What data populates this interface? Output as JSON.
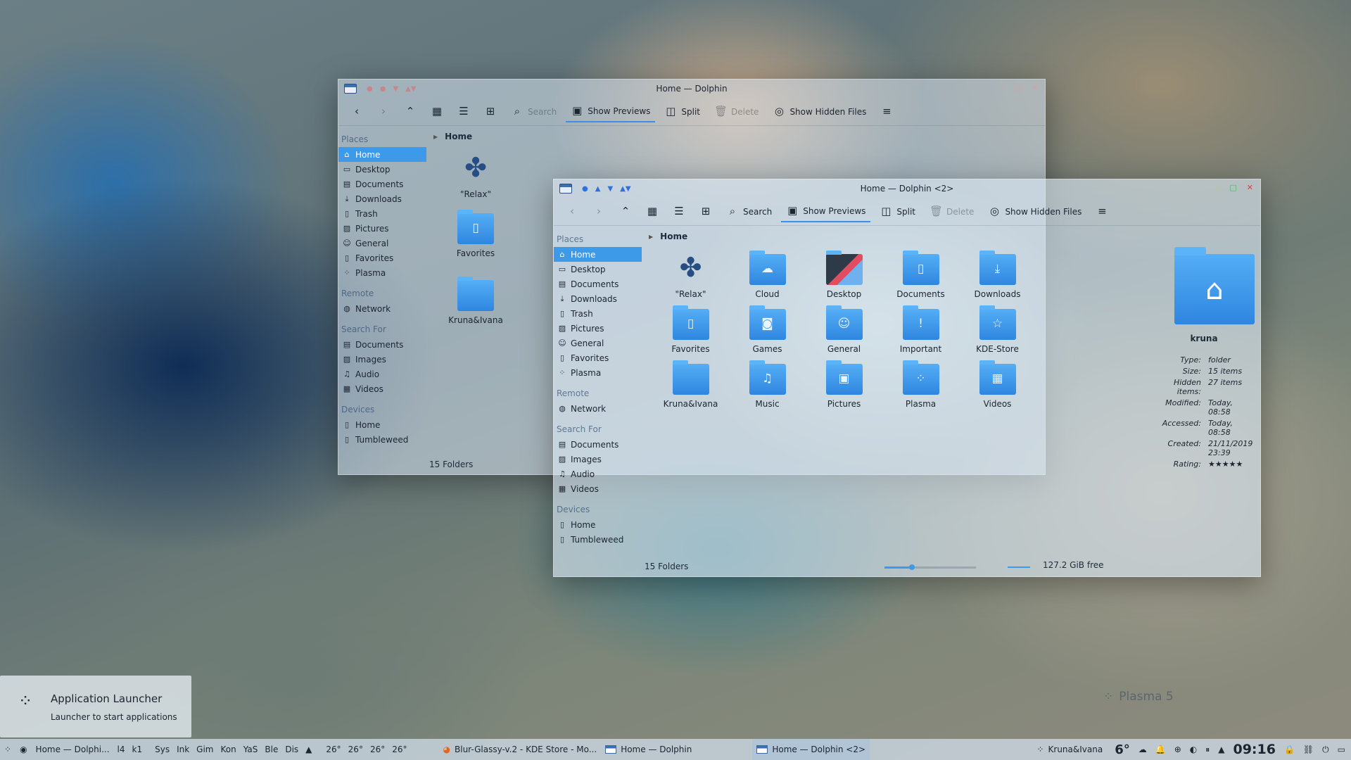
{
  "back_window": {
    "title": "Home — Dolphin",
    "toolbar": {
      "search": "Search",
      "show_previews": "Show Previews",
      "split": "Split",
      "delete": "Delete",
      "show_hidden": "Show Hidden Files"
    },
    "places_head": "Places",
    "places": [
      "Home",
      "Desktop",
      "Documents",
      "Downloads",
      "Trash",
      "Pictures",
      "General",
      "Favorites",
      "Plasma"
    ],
    "remote_head": "Remote",
    "remote": [
      "Network"
    ],
    "search_head": "Search For",
    "search_for": [
      "Documents",
      "Images",
      "Audio",
      "Videos"
    ],
    "devices_head": "Devices",
    "devices": [
      "Home",
      "Tumbleweed"
    ],
    "breadcrumb": "Home",
    "files": [
      "\"Relax\"",
      "Favorites",
      "Kruna&Ivana"
    ],
    "status": "15 Folders"
  },
  "front_window": {
    "title": "Home — Dolphin <2>",
    "toolbar": {
      "search": "Search",
      "show_previews": "Show Previews",
      "split": "Split",
      "delete": "Delete",
      "show_hidden": "Show Hidden Files"
    },
    "places_head": "Places",
    "places": [
      "Home",
      "Desktop",
      "Documents",
      "Downloads",
      "Trash",
      "Pictures",
      "General",
      "Favorites",
      "Plasma"
    ],
    "remote_head": "Remote",
    "remote": [
      "Network"
    ],
    "search_head": "Search For",
    "search_for": [
      "Documents",
      "Images",
      "Audio",
      "Videos"
    ],
    "devices_head": "Devices",
    "devices": [
      "Home",
      "Tumbleweed"
    ],
    "breadcrumb": "Home",
    "files": [
      {
        "name": "\"Relax\"",
        "icon": "relax-icon"
      },
      {
        "name": "Cloud",
        "icon": "cloud-icon"
      },
      {
        "name": "Desktop",
        "icon": "desktop-icon"
      },
      {
        "name": "Documents",
        "icon": "document-icon"
      },
      {
        "name": "Downloads",
        "icon": "download-icon"
      },
      {
        "name": "Favorites",
        "icon": "bookmark-icon"
      },
      {
        "name": "Games",
        "icon": "gamepad-icon"
      },
      {
        "name": "General",
        "icon": "people-icon"
      },
      {
        "name": "Important",
        "icon": "exclamation-icon"
      },
      {
        "name": "KDE-Store",
        "icon": "star-icon"
      },
      {
        "name": "Kruna&Ivana",
        "icon": "folder-icon"
      },
      {
        "name": "Music",
        "icon": "music-icon"
      },
      {
        "name": "Pictures",
        "icon": "picture-icon"
      },
      {
        "name": "Plasma",
        "icon": "plasma-icon"
      },
      {
        "name": "Videos",
        "icon": "film-icon"
      }
    ],
    "info": {
      "name": "kruna",
      "type_k": "Type:",
      "type_v": "folder",
      "size_k": "Size:",
      "size_v": "15 items",
      "hidden_k": "Hidden items:",
      "hidden_v": "27 items",
      "modified_k": "Modified:",
      "modified_v": "Today, 08:58",
      "accessed_k": "Accessed:",
      "accessed_v": "Today, 08:58",
      "created_k": "Created:",
      "created_v": "21/11/2019 23:39",
      "rating_k": "Rating:",
      "rating_stars": 5
    },
    "status": "15 Folders",
    "zoom_level": 0.3,
    "free_space": "127.2 GiB free"
  },
  "launcher_tooltip": {
    "title": "Application Launcher",
    "subtitle": "Launcher to start applications"
  },
  "desktop_watermark": "Plasma 5",
  "taskbar": {
    "task1": "Home — Dolphi...",
    "short_a": [
      "l4",
      "k1"
    ],
    "short_b": [
      "Sys",
      "Ink",
      "Gim",
      "Kon",
      "YaS",
      "Ble",
      "Dis"
    ],
    "temps": [
      "26°",
      "26°",
      "26°",
      "26°"
    ],
    "task_firefox": "Blur-Glassy-v.2 - KDE Store - Mo...",
    "task_dolphin1": "Home — Dolphin",
    "task_dolphin2": "Home — Dolphin <2>",
    "user": "Kruna&Ivana",
    "weather_temp": "6°",
    "clock": "09:16"
  }
}
